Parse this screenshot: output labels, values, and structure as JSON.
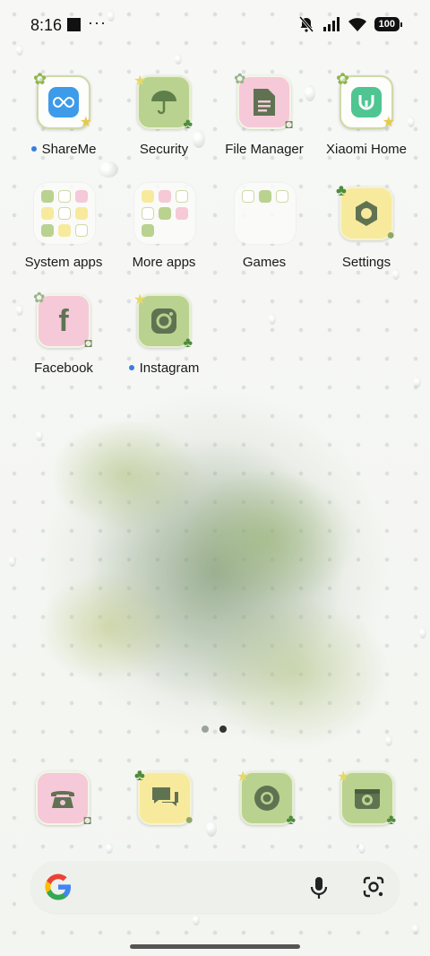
{
  "status_bar": {
    "time": "8:16",
    "overflow": "···",
    "battery": "100",
    "icons": [
      "bell-muted-icon",
      "signal-icon",
      "wifi-icon",
      "battery-icon"
    ]
  },
  "apps": [
    {
      "label": "ShareMe",
      "icon": "shareme-icon",
      "new": true
    },
    {
      "label": "Security",
      "icon": "umbrella-icon",
      "new": false
    },
    {
      "label": "File Manager",
      "icon": "file-icon",
      "new": false
    },
    {
      "label": "Xiaomi Home",
      "icon": "xiaomi-home-icon",
      "new": false
    },
    {
      "label": "System apps",
      "icon": "folder-icon",
      "new": false
    },
    {
      "label": "More apps",
      "icon": "folder-icon",
      "new": false
    },
    {
      "label": "Games",
      "icon": "folder-icon",
      "new": false
    },
    {
      "label": "Settings",
      "icon": "gear-icon",
      "new": false
    },
    {
      "label": "Facebook",
      "icon": "facebook-icon",
      "new": false
    },
    {
      "label": "Instagram",
      "icon": "instagram-icon",
      "new": true
    }
  ],
  "dock": [
    "phone-icon",
    "messages-icon",
    "chrome-icon",
    "camera-icon"
  ],
  "pages": {
    "count": 2,
    "active": 2
  },
  "search": {
    "placeholder": ""
  },
  "colors": {
    "accent_dot": "#3a7de0",
    "icon_green": "#b9d28f",
    "icon_pink": "#f5c9d8",
    "icon_yellow": "#f8ea9d"
  }
}
